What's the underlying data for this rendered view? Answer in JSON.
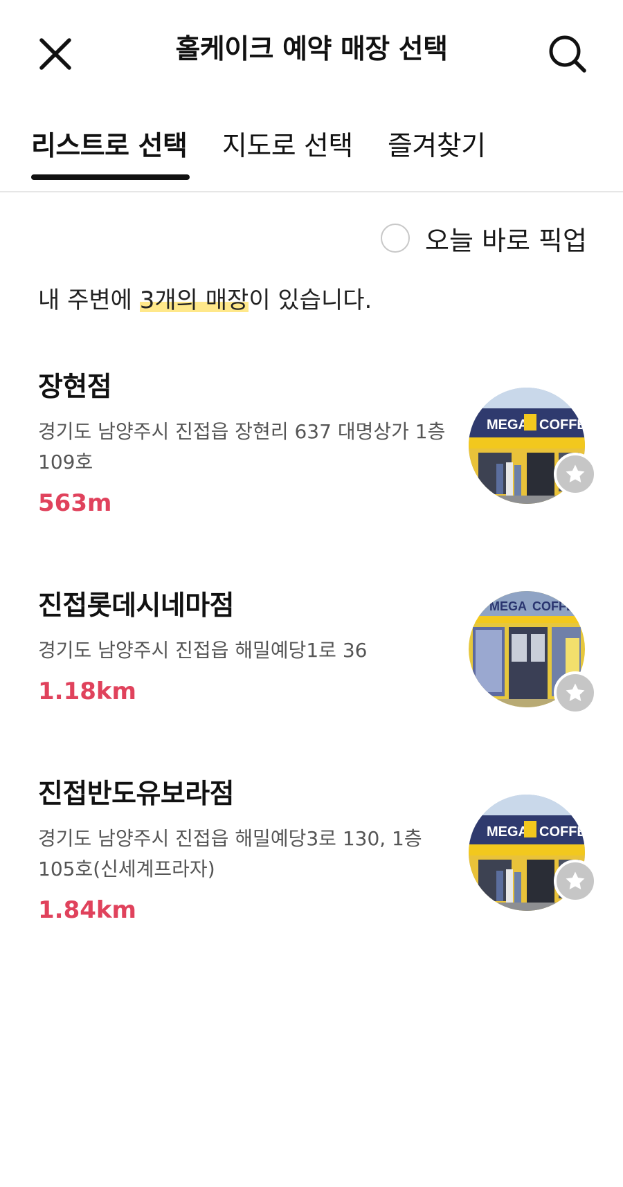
{
  "header": {
    "title": "홀케이크 예약 매장 선택"
  },
  "tabs": [
    {
      "label": "리스트로 선택",
      "active": true
    },
    {
      "label": "지도로 선택",
      "active": false
    },
    {
      "label": "즐겨찾기",
      "active": false
    }
  ],
  "filter": {
    "today_pickup_label": "오늘 바로 픽업",
    "checked": false
  },
  "summary": {
    "prefix": "내 주변에 ",
    "highlight": "3개의 매장",
    "suffix": "이 있습니다."
  },
  "stores": [
    {
      "name": "장현점",
      "address": "경기도 남양주시 진접읍 장현리 637 대명상가 1층 109호",
      "distance": "563m",
      "photo_sign_left": "MEGA",
      "photo_sign_right": "COFFEE"
    },
    {
      "name": "진접롯데시네마점",
      "address": "경기도 남양주시 진접읍 해밀예당1로 36",
      "distance": "1.18km",
      "photo_sign_left": "MEGA",
      "photo_sign_right": "COFFEE"
    },
    {
      "name": "진접반도유보라점",
      "address": "경기도 남양주시 진접읍 해밀예당3로 130, 1층 105호(신세계프라자)",
      "distance": "1.84km",
      "photo_sign_left": "MEGA",
      "photo_sign_right": "COFFEE"
    }
  ],
  "colors": {
    "distance": "#e0425c",
    "highlight": "#ffe88a",
    "favorite_button": "#c6c6c6",
    "sign_yellow": "#f2c81e"
  },
  "icons": {
    "close": "close-icon",
    "search": "search-icon",
    "favorite": "star-icon"
  }
}
